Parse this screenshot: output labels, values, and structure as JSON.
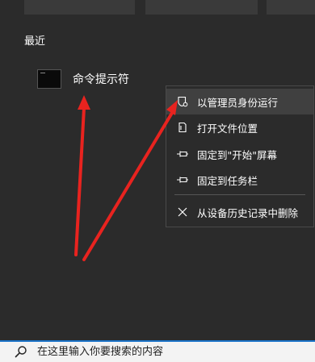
{
  "recent": {
    "title": "最近",
    "items": [
      {
        "label": "命令提示符",
        "icon": "cmd-icon"
      }
    ]
  },
  "context_menu": {
    "items": [
      {
        "label": "以管理员身份运行",
        "icon": "admin-shield-icon",
        "highlighted": true
      },
      {
        "label": "打开文件位置",
        "icon": "file-location-icon"
      },
      {
        "label": "固定到\"开始\"屏幕",
        "icon": "pin-icon"
      },
      {
        "label": "固定到任务栏",
        "icon": "pin-icon"
      },
      {
        "label": "从设备历史记录中删除",
        "icon": "close-icon"
      }
    ]
  },
  "search": {
    "placeholder": "在这里输入你要搜索的内容",
    "icon": "search-icon"
  },
  "colors": {
    "background": "#2b2b2b",
    "menu_hover": "#404040",
    "arrow": "#e8231f",
    "search_border": "#1a73c8"
  }
}
